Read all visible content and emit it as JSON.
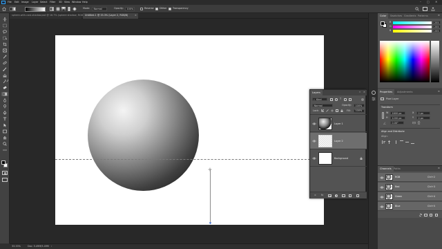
{
  "menu": [
    "File",
    "Edit",
    "Image",
    "Layer",
    "Select",
    "Filter",
    "3D",
    "View",
    "Window",
    "Help"
  ],
  "options_bar": {
    "mode_label": "Mode:",
    "mode_value": "Normal",
    "opacity_label": "Opacity:",
    "opacity_value": "100%",
    "reverse_label": "Reverse",
    "dither_label": "Dither",
    "transparency_label": "Transparency"
  },
  "doc_tabs": [
    {
      "label": "sphere-with-cast-shadow.psd @ 16.7% (sphere shadow, RGB/8)",
      "active": false
    },
    {
      "label": "Untitled-1 @ 33.3% (Layer 2, RGB/8)",
      "active": true
    }
  ],
  "color_panel": {
    "tabs": [
      "Color",
      "Swatches",
      "Gradients",
      "Patterns"
    ],
    "channel_labels": [
      "R",
      "G",
      "B"
    ],
    "channel_values": [
      "255",
      "255",
      "255"
    ]
  },
  "properties_panel": {
    "tabs": [
      "Properties",
      "Adjustments"
    ],
    "kind_label": "Pixel Layer",
    "transform_header": "Transform",
    "w_label": "W",
    "w_value": "1600 px",
    "h_label": "H",
    "h_value": "1200 px",
    "x_label": "X",
    "x_value": "0 px",
    "y_label": "Y",
    "y_value": "0 px",
    "angle_value": "0.00°",
    "align_header": "Align and Distribute",
    "align_sub": "Align:"
  },
  "layers_panel": {
    "title": "Layers",
    "filter_label": "Kind",
    "blend_mode": "Normal",
    "opacity_label": "Opacity:",
    "opacity_value": "100%",
    "lock_label": "Lock:",
    "fill_label": "Fill:",
    "fill_value": "100%",
    "layers": [
      {
        "name": "Layer 1",
        "selected": false,
        "thumb": "sphere"
      },
      {
        "name": "Layer 2",
        "selected": true,
        "thumb": "transparent"
      },
      {
        "name": "Background",
        "selected": false,
        "thumb": "white"
      }
    ]
  },
  "channels_panel": {
    "tabs": [
      "Channels",
      "Paths"
    ],
    "channels": [
      {
        "name": "RGB",
        "shortcut": "Ctrl+2"
      },
      {
        "name": "Red",
        "shortcut": "Ctrl+3"
      },
      {
        "name": "Green",
        "shortcut": "Ctrl+4"
      },
      {
        "name": "Blue",
        "shortcut": "Ctrl+5"
      }
    ]
  },
  "status": {
    "zoom": "33.33%",
    "doc_size": "Doc: 5.49M/5.49M"
  },
  "colors": {
    "app_bg": "#282828",
    "panel_bg": "#535353",
    "dark_panel_bg": "#323232",
    "canvas": "#ffffff",
    "accent": "#1473e6",
    "selected_layer": "#6e6e6e"
  }
}
